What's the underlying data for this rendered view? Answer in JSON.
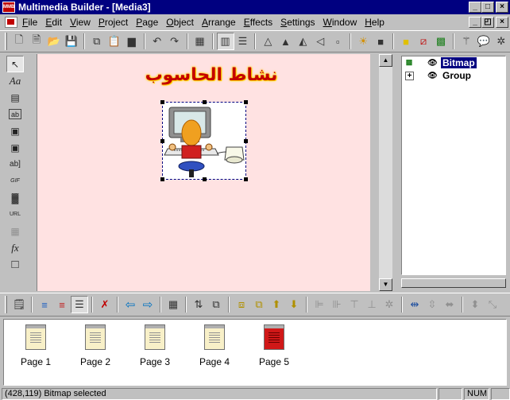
{
  "window": {
    "title": "Multimedia Builder - [Media3]",
    "app_icon": "MMB",
    "buttons": [
      "_",
      "□",
      "×"
    ],
    "mdi_buttons": [
      "_",
      "◰",
      "×"
    ]
  },
  "menu": [
    "File",
    "Edit",
    "View",
    "Project",
    "Page",
    "Object",
    "Arrange",
    "Effects",
    "Settings",
    "Window",
    "Help"
  ],
  "toolbar_icons": [
    {
      "name": "new-icon",
      "glyph": "🗋"
    },
    {
      "name": "new-page-icon",
      "glyph": "🗎"
    },
    {
      "name": "open-icon",
      "glyph": "📂"
    },
    {
      "name": "save-icon",
      "glyph": "💾"
    },
    {
      "name": "copy-icon",
      "glyph": "⧉"
    },
    {
      "name": "paste-icon",
      "glyph": "📋"
    },
    {
      "name": "clipboard-icon",
      "glyph": "▆"
    },
    {
      "name": "undo-icon",
      "glyph": "↶"
    },
    {
      "name": "redo-icon",
      "glyph": "↷"
    },
    {
      "name": "script-icon",
      "glyph": "▦"
    },
    {
      "name": "grid-icon",
      "glyph": "▥"
    },
    {
      "name": "layers-icon",
      "glyph": "☰"
    },
    {
      "name": "drop-icon",
      "glyph": "△"
    },
    {
      "name": "triangle-icon",
      "glyph": "▲"
    },
    {
      "name": "flip-horizontal-icon",
      "glyph": "◭"
    },
    {
      "name": "flip-vertical-icon",
      "glyph": "◁"
    },
    {
      "name": "group-icon",
      "glyph": "▫"
    },
    {
      "name": "light-icon",
      "glyph": "☀"
    },
    {
      "name": "fill-icon",
      "glyph": "■"
    },
    {
      "name": "color-icon",
      "glyph": "■"
    },
    {
      "name": "line-color-icon",
      "glyph": "⧄"
    },
    {
      "name": "image-icon",
      "glyph": "▩"
    },
    {
      "name": "magic-wand-icon",
      "glyph": "⚚"
    },
    {
      "name": "speech-bubble-icon",
      "glyph": "💬"
    },
    {
      "name": "sparkle-icon",
      "glyph": "✲"
    }
  ],
  "left_tools": [
    {
      "name": "select-arrow-icon",
      "glyph": "↖"
    },
    {
      "name": "text-tool-icon",
      "glyph": "Aa"
    },
    {
      "name": "paragraph-tool-icon",
      "glyph": "▤"
    },
    {
      "name": "text-button-tool-icon",
      "glyph": "ab"
    },
    {
      "name": "bitmap-button-tool-icon",
      "glyph": "▣"
    },
    {
      "name": "animation-tool-icon",
      "glyph": "▣"
    },
    {
      "name": "text-input-tool-icon",
      "glyph": "ab]"
    },
    {
      "name": "gif-tool-icon",
      "glyph": "GIF"
    },
    {
      "name": "video-tool-icon",
      "glyph": "▓"
    },
    {
      "name": "url-tool-icon",
      "glyph": "URL"
    },
    {
      "name": "table-tool-icon",
      "glyph": "▦"
    },
    {
      "name": "effect-tool-icon",
      "glyph": "fx"
    },
    {
      "name": "rectangle-tool-icon",
      "glyph": "□"
    }
  ],
  "canvas": {
    "title_text": "نشاط الحاسوب",
    "background": "#ffe2e2",
    "title_color": "#c40000",
    "title_glow": "#ffd800"
  },
  "object_tree": {
    "items": [
      {
        "label": "Bitmap",
        "selected": true,
        "icon": "bitmap-icon"
      },
      {
        "label": "Group",
        "selected": false,
        "icon": "expand-icon"
      }
    ]
  },
  "toolbar2_icons": [
    {
      "name": "page-properties-icon",
      "glyph": "🗒"
    },
    {
      "name": "stack-icon",
      "glyph": "≡"
    },
    {
      "name": "stack-red-icon",
      "glyph": "≡"
    },
    {
      "name": "stack-pressed-icon",
      "glyph": "☰"
    },
    {
      "name": "delete-page-icon",
      "glyph": "✗"
    },
    {
      "name": "previous-page-icon",
      "glyph": "⇦"
    },
    {
      "name": "next-page-icon",
      "glyph": "⇨"
    },
    {
      "name": "page-script-icon",
      "glyph": "▦"
    },
    {
      "name": "sort-icon",
      "glyph": "⇅"
    },
    {
      "name": "page-copy-icon",
      "glyph": "⧉"
    },
    {
      "name": "bring-front-icon",
      "glyph": "⧈"
    },
    {
      "name": "send-back-icon",
      "glyph": "⧉"
    },
    {
      "name": "forward-icon",
      "glyph": "⬆"
    },
    {
      "name": "backward-icon",
      "glyph": "⬇"
    },
    {
      "name": "align-left-icon",
      "glyph": "⊫"
    },
    {
      "name": "align-center-icon",
      "glyph": "⊪"
    },
    {
      "name": "align-top-icon",
      "glyph": "⊤"
    },
    {
      "name": "align-middle-icon",
      "glyph": "⊥"
    },
    {
      "name": "align-gear-icon",
      "glyph": "✲"
    },
    {
      "name": "space-horizontal-icon",
      "glyph": "⇹"
    },
    {
      "name": "space-vertical-icon",
      "glyph": "⇳"
    },
    {
      "name": "same-width-icon",
      "glyph": "⬌"
    },
    {
      "name": "same-size-icon",
      "glyph": "⬍"
    },
    {
      "name": "resize-icon",
      "glyph": "⤡"
    }
  ],
  "pages": [
    {
      "label": "Page 1",
      "active": false
    },
    {
      "label": "Page 2",
      "active": false
    },
    {
      "label": "Page 3",
      "active": false
    },
    {
      "label": "Page 4",
      "active": false
    },
    {
      "label": "Page 5",
      "active": true
    }
  ],
  "status": {
    "message": "(428,119)  Bitmap selected",
    "num": "NUM"
  }
}
